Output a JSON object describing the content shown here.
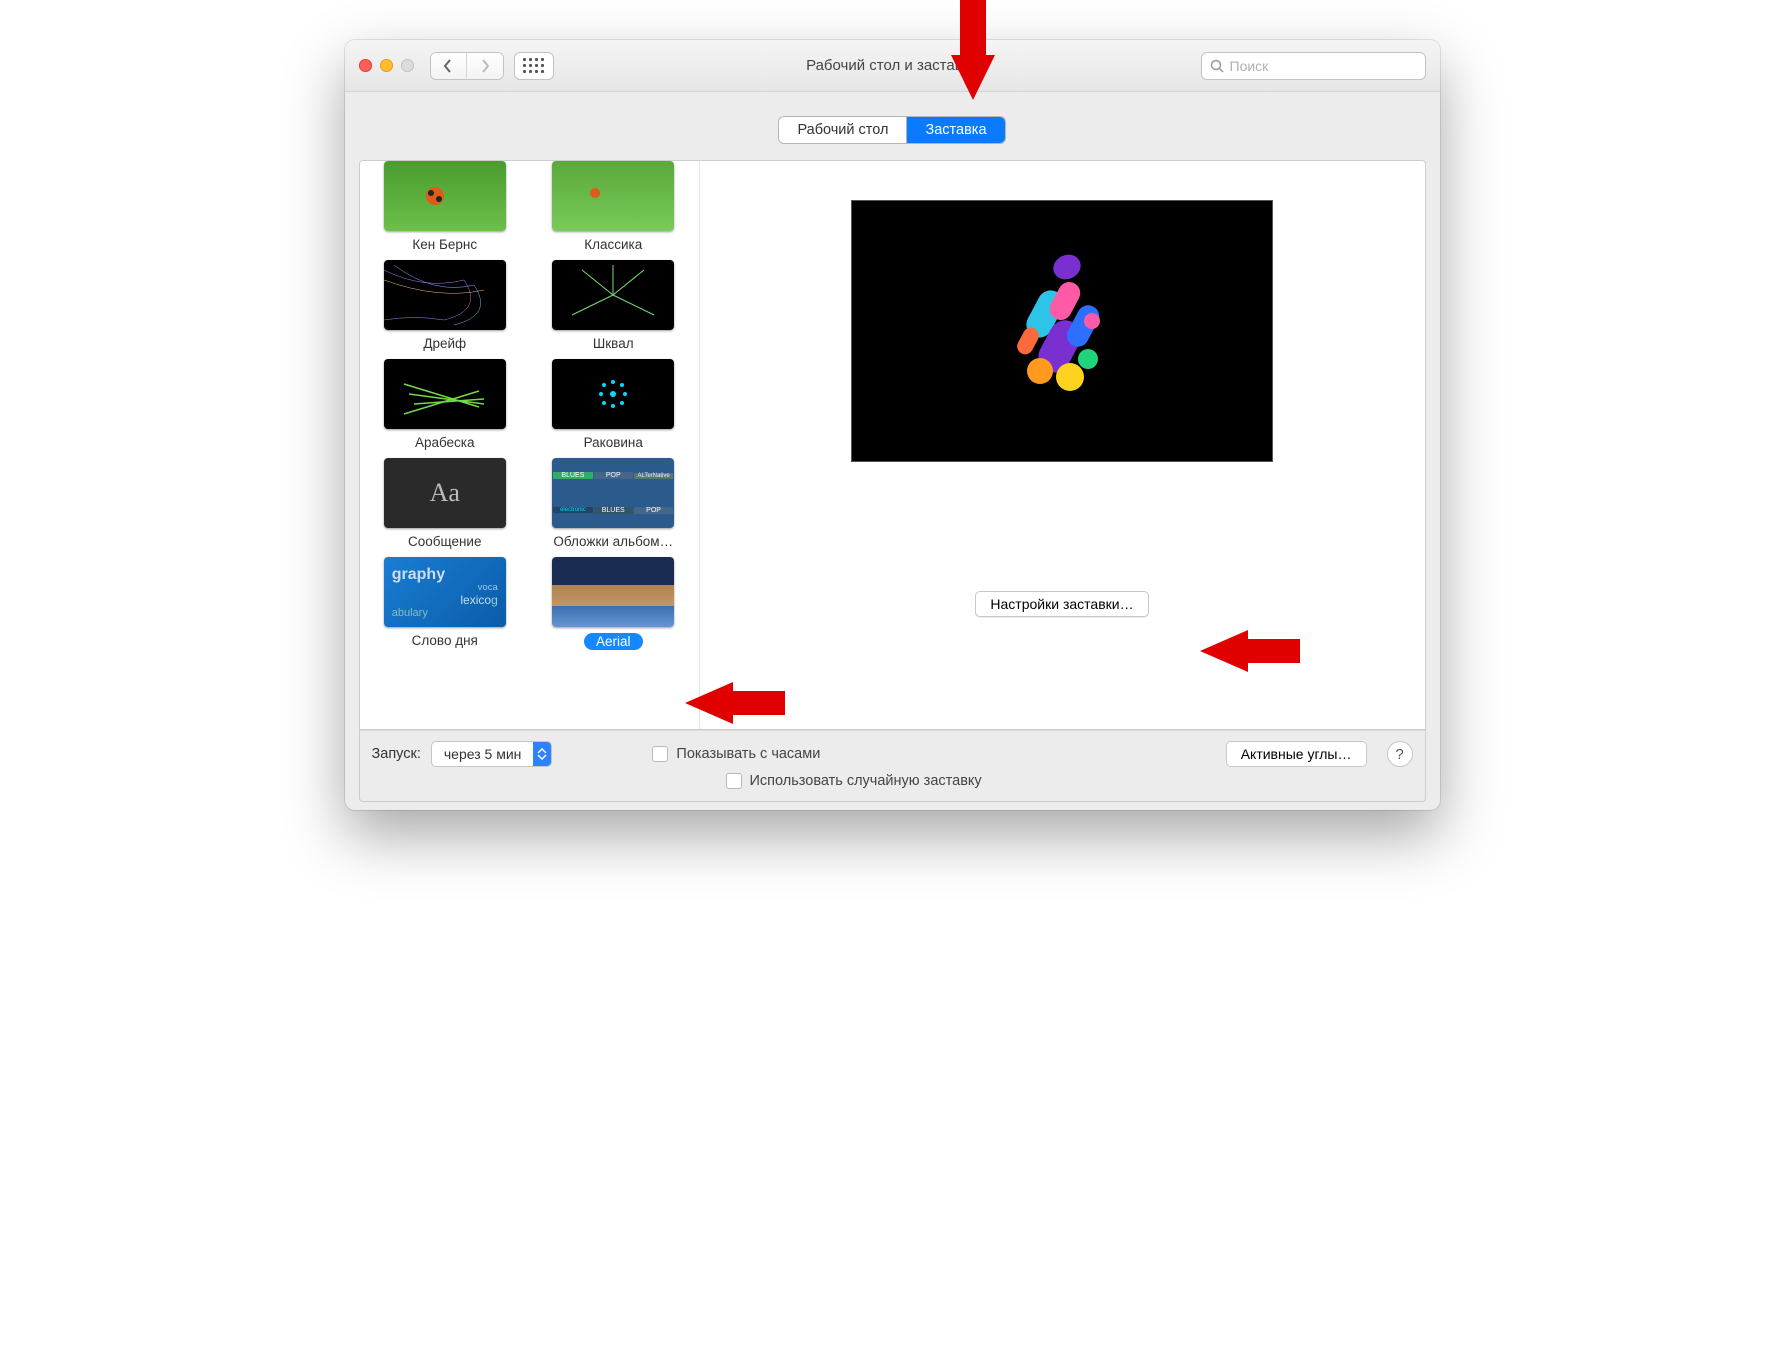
{
  "window": {
    "title": "Рабочий стол и заставка"
  },
  "search": {
    "placeholder": "Поиск"
  },
  "tabs": {
    "desktop": "Рабочий стол",
    "screensaver": "Заставка",
    "active": "screensaver"
  },
  "screensavers": [
    {
      "label": "Кен Бернс",
      "thumb": "kenburns"
    },
    {
      "label": "Классика",
      "thumb": "classic"
    },
    {
      "label": "Дрейф",
      "thumb": "drift"
    },
    {
      "label": "Шквал",
      "thumb": "flurry"
    },
    {
      "label": "Арабеска",
      "thumb": "arabesque"
    },
    {
      "label": "Раковина",
      "thumb": "shell"
    },
    {
      "label": "Сообщение",
      "thumb": "message"
    },
    {
      "label": "Обложки альбом…",
      "thumb": "albums"
    },
    {
      "label": "Слово дня",
      "thumb": "word"
    },
    {
      "label": "Aerial",
      "thumb": "aerial",
      "selected": true
    }
  ],
  "settings_button": "Настройки заставки…",
  "footer": {
    "start_label": "Запуск:",
    "start_value": "через 5 мин",
    "show_clock": "Показывать с часами",
    "random": "Использовать случайную заставку",
    "hot_corners": "Активные углы…",
    "help": "?"
  }
}
